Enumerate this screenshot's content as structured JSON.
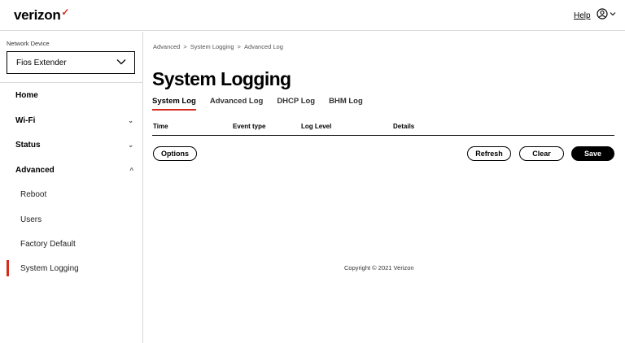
{
  "header": {
    "logo_text": "verizon",
    "logo_mark": "✓",
    "help_label": "Help",
    "user_icon": "user-circle-icon",
    "brand_accent": "#d52b1e"
  },
  "sidebar": {
    "device_label": "Network Device",
    "device_selected": "Fios Extender",
    "items": [
      {
        "label": "Home",
        "arrow": ""
      },
      {
        "label": "Wi-Fi",
        "arrow": "⌄"
      },
      {
        "label": "Status",
        "arrow": "⌄"
      },
      {
        "label": "Advanced",
        "arrow": "^"
      },
      {
        "label": "Reboot"
      },
      {
        "label": "Users"
      },
      {
        "label": "Factory Default"
      },
      {
        "label": "System Logging"
      }
    ]
  },
  "main": {
    "breadcrumb": [
      "Advanced",
      "System Logging",
      "Advanced Log"
    ],
    "breadcrumb_sep": ">",
    "title": "System Logging",
    "tabs": [
      "System Log",
      "Advanced Log",
      "DHCP Log",
      "BHM Log"
    ],
    "columns": [
      "Time",
      "Event type",
      "Log Level",
      "Details"
    ],
    "buttons": {
      "options": "Options",
      "refresh": "Refresh",
      "clear": "Clear",
      "save": "Save"
    }
  },
  "footer": {
    "copyright": "Copyright © 2021 Verizon"
  }
}
